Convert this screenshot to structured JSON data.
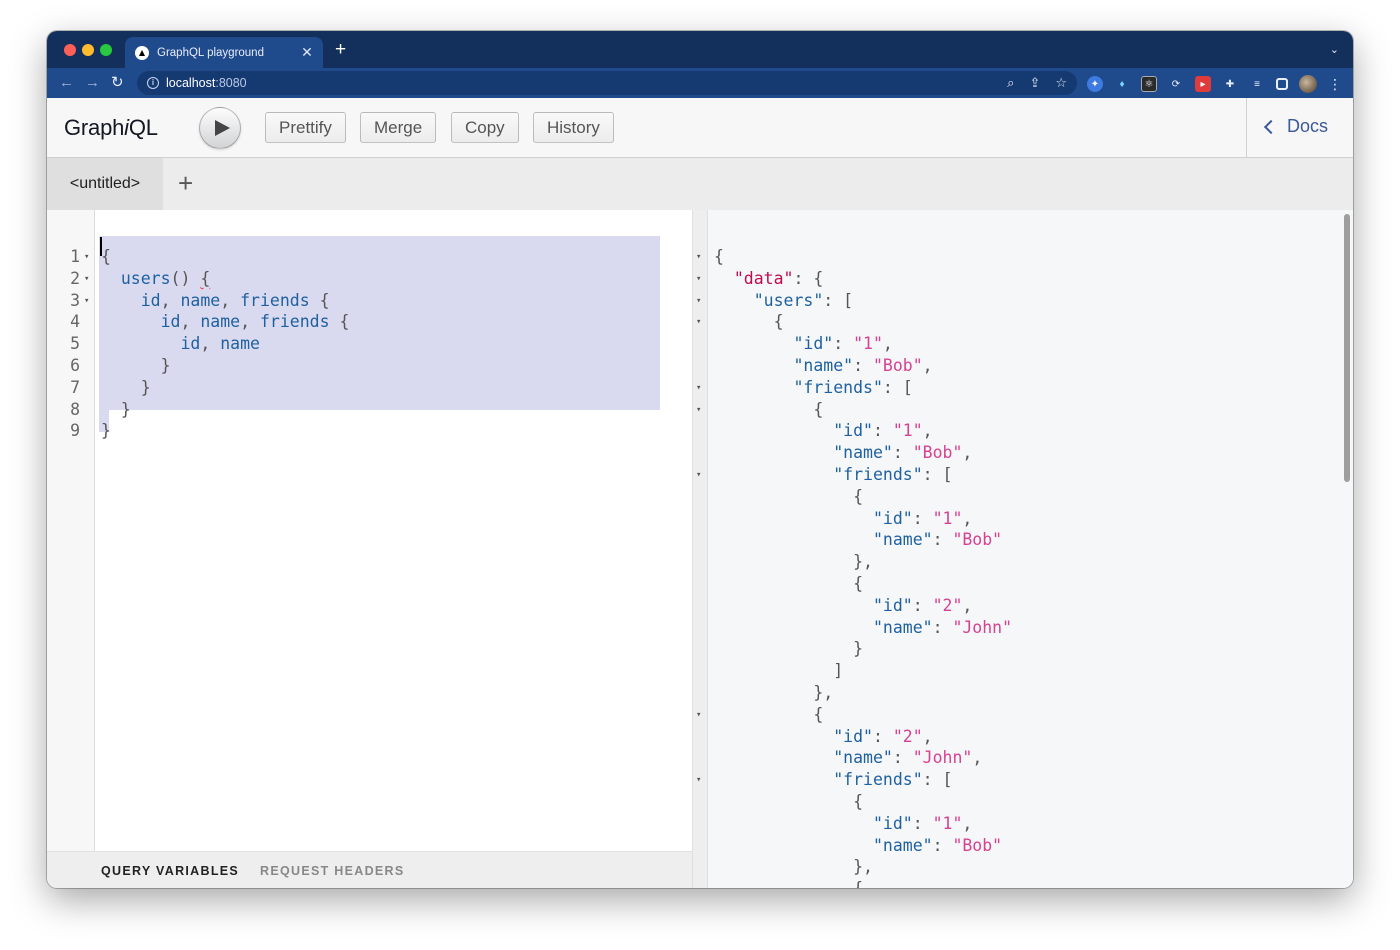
{
  "browser": {
    "tab_title": "GraphQL playground",
    "new_tab_symbol": "+",
    "close_symbol": "✕",
    "url_host": "localhost",
    "url_port": ":8080"
  },
  "graphiql": {
    "title_pre": "Graph",
    "title_i": "i",
    "title_post": "QL",
    "buttons": {
      "prettify": "Prettify",
      "merge": "Merge",
      "copy": "Copy",
      "history": "History"
    },
    "docs_label": "Docs",
    "active_tab": "<untitled>",
    "add_tab": "+",
    "footer_tabs": {
      "query_variables": "QUERY VARIABLES",
      "request_headers": "REQUEST HEADERS"
    }
  },
  "query_editor": {
    "line_numbers": [
      "1",
      "2",
      "3",
      "4",
      "5",
      "6",
      "7",
      "8",
      "9"
    ],
    "folded_lines": [
      1,
      2,
      3
    ]
  },
  "query_lines": [
    "{",
    "  users() {",
    "    id, name, friends {",
    "      id, name, friends {",
    "        id, name",
    "      }",
    "    }",
    "  }",
    "}"
  ],
  "result_lines": [
    "{",
    "  \"data\": {",
    "    \"users\": [",
    "      {",
    "        \"id\": \"1\",",
    "        \"name\": \"Bob\",",
    "        \"friends\": [",
    "          {",
    "            \"id\": \"1\",",
    "            \"name\": \"Bob\",",
    "            \"friends\": [",
    "              {",
    "                \"id\": \"1\",",
    "                \"name\": \"Bob\"",
    "              },",
    "              {",
    "                \"id\": \"2\",",
    "                \"name\": \"John\"",
    "              }",
    "            ]",
    "          },",
    "          {",
    "            \"id\": \"2\",",
    "            \"name\": \"John\",",
    "            \"friends\": [",
    "              {",
    "                \"id\": \"1\",",
    "                \"name\": \"Bob\"",
    "              },",
    "              {"
  ],
  "result_fold_lines": [
    0,
    1,
    2,
    3,
    6,
    7,
    10,
    21,
    24
  ],
  "colors": {
    "tab_strip": "#132f5b",
    "toolbar": "#1f4a8c",
    "keyword": "#1f61a0",
    "string": "#d64292",
    "selection": "#d9d9f0",
    "docs": "#3b5998"
  }
}
